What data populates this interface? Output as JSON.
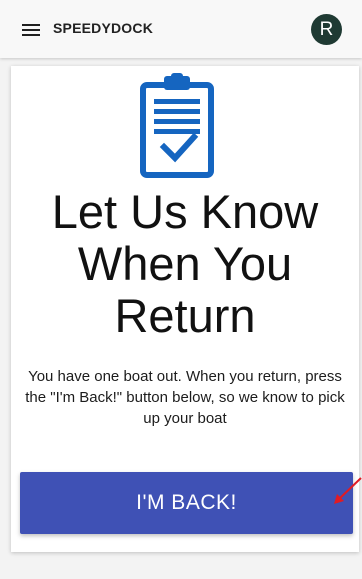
{
  "app": {
    "brand": "SPEEDYDOCK",
    "avatar_initial": "R"
  },
  "icons": {
    "menu": "hamburger-menu-icon",
    "clipboard": "clipboard-check-icon",
    "annotation": "red-arrow-icon"
  },
  "main": {
    "headline": "Let Us Know\nWhen You\nReturn",
    "description": "You have one boat out. When you return, press the \"I'm Back!\" button below, so we know to pick up your boat",
    "back_button_label": "I'M BACK!"
  },
  "colors": {
    "accent": "#3f51b5",
    "icon_blue": "#1565c0",
    "avatar_bg": "#1f3a33",
    "annotation": "#e01b24"
  }
}
